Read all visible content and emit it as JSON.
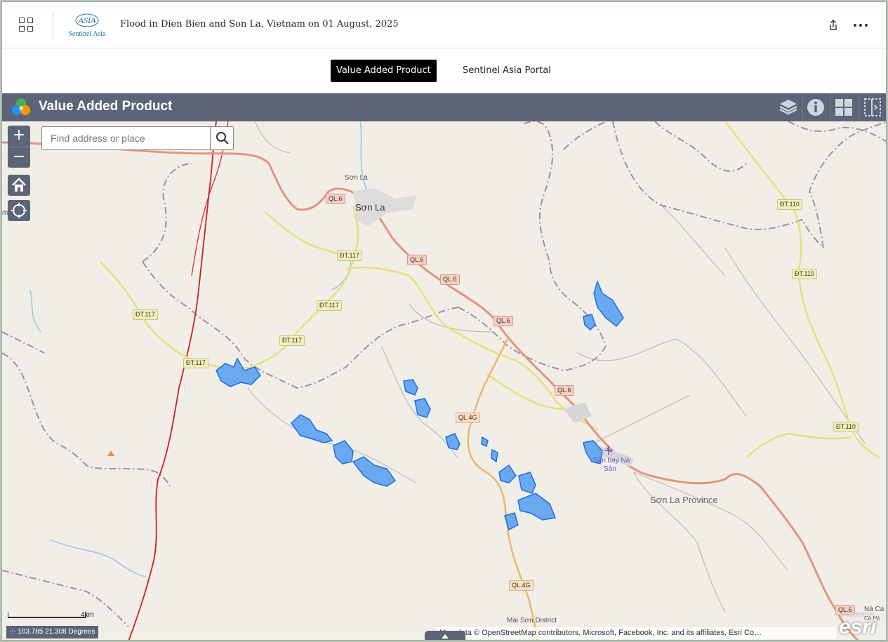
{
  "header": {
    "title": "Flood in Dien Bien and Son La, Vietnam on 01 August, 2025",
    "logo_text": "Sentinel Asia",
    "logo_mark": "ASIA"
  },
  "tabs": [
    {
      "label": "Value Added Product",
      "active": true
    },
    {
      "label": "Sentinel Asia Portal",
      "active": false
    }
  ],
  "map_widget": {
    "title": "Value Added Product",
    "search_placeholder": "Find address or place",
    "zoom_in": "+",
    "zoom_out": "−"
  },
  "map_labels": {
    "son_la_small": "Sơn La",
    "son_la_city": "Sơn La",
    "province": "Sơn La Province",
    "district": "Mai Sơn District",
    "airport_1": "Sân bay Nà",
    "airport_2": "Sản",
    "na_cai": "Nà Ca",
    "co_no": "Cò Nò",
    "m_edge": "m"
  },
  "road_shields": {
    "ql6": "QL.6",
    "dt117": "ĐT.117",
    "dt110": "ĐT.110",
    "ql4g": "QL.4G"
  },
  "footer": {
    "scale": "4km",
    "coordinates": "103.785 21.308 Degrees",
    "attribution": "Map data © OpenStreetMap contributors, Microsoft, Facebook, Inc. and its affiliates, Esri Co…",
    "esri_powered": "POWERED BY",
    "esri_word": "esri"
  },
  "colors": {
    "widget_bar": "#5b6577",
    "flood": "#1f6fe0",
    "national_road": "#e8937a",
    "province_road": "#e4e27a",
    "boundary": "#a48ea5",
    "red_boundary": "#d42020"
  }
}
